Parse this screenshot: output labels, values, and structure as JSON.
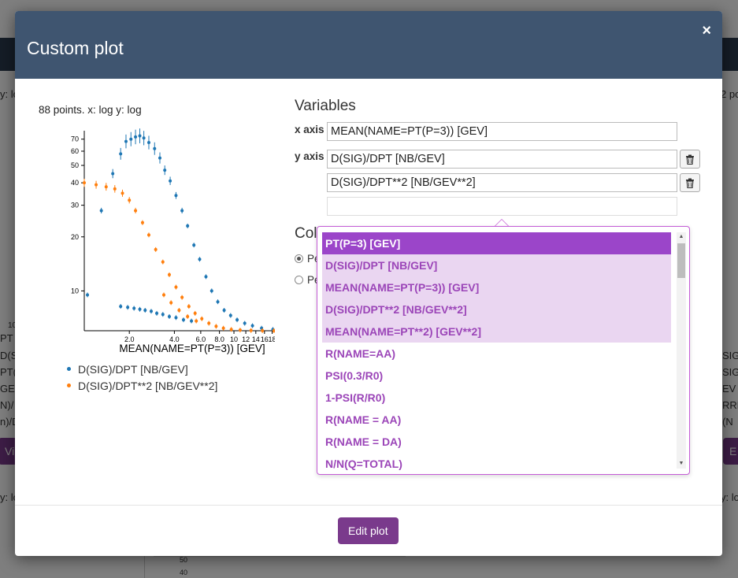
{
  "background": {
    "left_texts": [
      "y: lo",
      "10",
      "PT",
      "D(SIG",
      "PT(P",
      "GEV",
      "N)/",
      "n)/D",
      "y: lo"
    ],
    "right_texts": [
      "2 po",
      "SIG",
      "SIG",
      "EV",
      "RRE",
      "(N",
      "y: lo"
    ],
    "left_button": "Vi",
    "right_button": "E",
    "chart_ticks": [
      "50",
      "40"
    ]
  },
  "modal": {
    "title": "Custom plot",
    "close_label": "×"
  },
  "plot": {
    "info": "88 points. x: log y: log",
    "x_tick_labels": [
      "2.0",
      "4.0",
      "6.0",
      "8.0",
      "10",
      "12",
      "14",
      "16",
      "18"
    ],
    "y_tick_labels": [
      "70",
      "60",
      "50",
      "40",
      "30",
      "20",
      "10"
    ],
    "xlabel": "MEAN(NAME=PT(P=3)) [GEV]",
    "legend": [
      {
        "label": "D(SIG)/DPT [NB/GEV]",
        "color": "#1f77b4"
      },
      {
        "label": "D(SIG)/DPT**2 [NB/GEV**2]",
        "color": "#ff7f0e"
      }
    ]
  },
  "chart_data": {
    "type": "scatter",
    "xlabel": "MEAN(NAME=PT(P=3)) [GEV]",
    "ylabel": "",
    "xscale": "log",
    "yscale": "log",
    "xlim": [
      1.0,
      19.0
    ],
    "ylim": [
      6.0,
      78.0
    ],
    "error_bars": true,
    "series": [
      {
        "name": "D(SIG)/DPT [NB/GEV]",
        "color": "#1f77b4",
        "points": [
          [
            1.05,
            9.5
          ],
          [
            1.3,
            28
          ],
          [
            1.55,
            45
          ],
          [
            1.75,
            58
          ],
          [
            1.9,
            68
          ],
          [
            2.05,
            70
          ],
          [
            2.2,
            72
          ],
          [
            2.35,
            73
          ],
          [
            2.5,
            71
          ],
          [
            2.7,
            67
          ],
          [
            2.95,
            62
          ],
          [
            3.2,
            55
          ],
          [
            3.45,
            47
          ],
          [
            3.75,
            41
          ],
          [
            4.1,
            34
          ],
          [
            4.5,
            28
          ],
          [
            4.9,
            23
          ],
          [
            5.4,
            18
          ],
          [
            5.9,
            15
          ],
          [
            6.5,
            12
          ],
          [
            7.1,
            10
          ],
          [
            7.8,
            8.7
          ],
          [
            8.6,
            7.8
          ],
          [
            9.5,
            7.3
          ],
          [
            10.5,
            6.9
          ],
          [
            11.8,
            6.6
          ],
          [
            13.3,
            6.4
          ],
          [
            15.3,
            6.2
          ],
          [
            18.2,
            6.1
          ],
          [
            1.75,
            8.2
          ],
          [
            1.95,
            8.1
          ],
          [
            2.15,
            8.0
          ],
          [
            2.35,
            7.9
          ],
          [
            2.55,
            7.8
          ],
          [
            2.8,
            7.7
          ],
          [
            3.05,
            7.5
          ],
          [
            3.35,
            7.4
          ],
          [
            3.7,
            7.2
          ],
          [
            4.1,
            7.1
          ],
          [
            4.6,
            6.9
          ],
          [
            5.2,
            6.8
          ]
        ]
      },
      {
        "name": "D(SIG)/DPT**2 [NB/GEV**2]",
        "color": "#ff7f0e",
        "points": [
          [
            1.0,
            40
          ],
          [
            1.2,
            39
          ],
          [
            1.4,
            38
          ],
          [
            1.6,
            37
          ],
          [
            1.8,
            35
          ],
          [
            2.0,
            32
          ],
          [
            2.2,
            28
          ],
          [
            2.45,
            24
          ],
          [
            2.7,
            20.5
          ],
          [
            3.0,
            17
          ],
          [
            3.35,
            14.5
          ],
          [
            3.7,
            12.3
          ],
          [
            4.1,
            10.5
          ],
          [
            4.5,
            9.2
          ],
          [
            5.0,
            8.2
          ],
          [
            5.5,
            7.5
          ],
          [
            6.1,
            7.0
          ],
          [
            6.8,
            6.6
          ],
          [
            7.6,
            6.35
          ],
          [
            8.5,
            6.2
          ],
          [
            9.6,
            6.1
          ],
          [
            11.0,
            6.05
          ],
          [
            13.0,
            6.02
          ],
          [
            15.5,
            6.01
          ],
          [
            18.5,
            6.0
          ],
          [
            3.4,
            9.5
          ],
          [
            3.8,
            8.6
          ],
          [
            4.3,
            7.8
          ],
          [
            4.9,
            7.2
          ],
          [
            5.6,
            6.8
          ]
        ]
      }
    ]
  },
  "variables": {
    "title": "Variables",
    "x_axis_label": "x axis",
    "y_axis_label": "y axis",
    "x_value": "MEAN(NAME=PT(P=3)) [GEV]",
    "y_values": [
      "D(SIG)/DPT [NB/GEV]",
      "D(SIG)/DPT**2 [NB/GEV**2]"
    ],
    "new_y_value": ""
  },
  "color_by": {
    "heading": "Col",
    "options": [
      "Pe",
      "Pe"
    ]
  },
  "dropdown": {
    "items": [
      {
        "label": "PT(P=3) [GEV]",
        "state": "active"
      },
      {
        "label": "D(SIG)/DPT [NB/GEV]",
        "state": "highlight"
      },
      {
        "label": "MEAN(NAME=PT(P=3)) [GEV]",
        "state": "highlight"
      },
      {
        "label": "D(SIG)/DPT**2 [NB/GEV**2]",
        "state": "highlight"
      },
      {
        "label": "MEAN(NAME=PT**2) [GEV**2]",
        "state": "highlight"
      },
      {
        "label": "R(NAME=AA)",
        "state": "normal"
      },
      {
        "label": "PSI(0.3/R0)",
        "state": "normal"
      },
      {
        "label": "1-PSI(R/R0)",
        "state": "normal"
      },
      {
        "label": "R(NAME = AA)",
        "state": "normal"
      },
      {
        "label": "R(NAME = DA)",
        "state": "normal"
      },
      {
        "label": "N/N(Q=TOTAL)",
        "state": "normal"
      }
    ]
  },
  "footer": {
    "edit_button": "Edit plot"
  }
}
